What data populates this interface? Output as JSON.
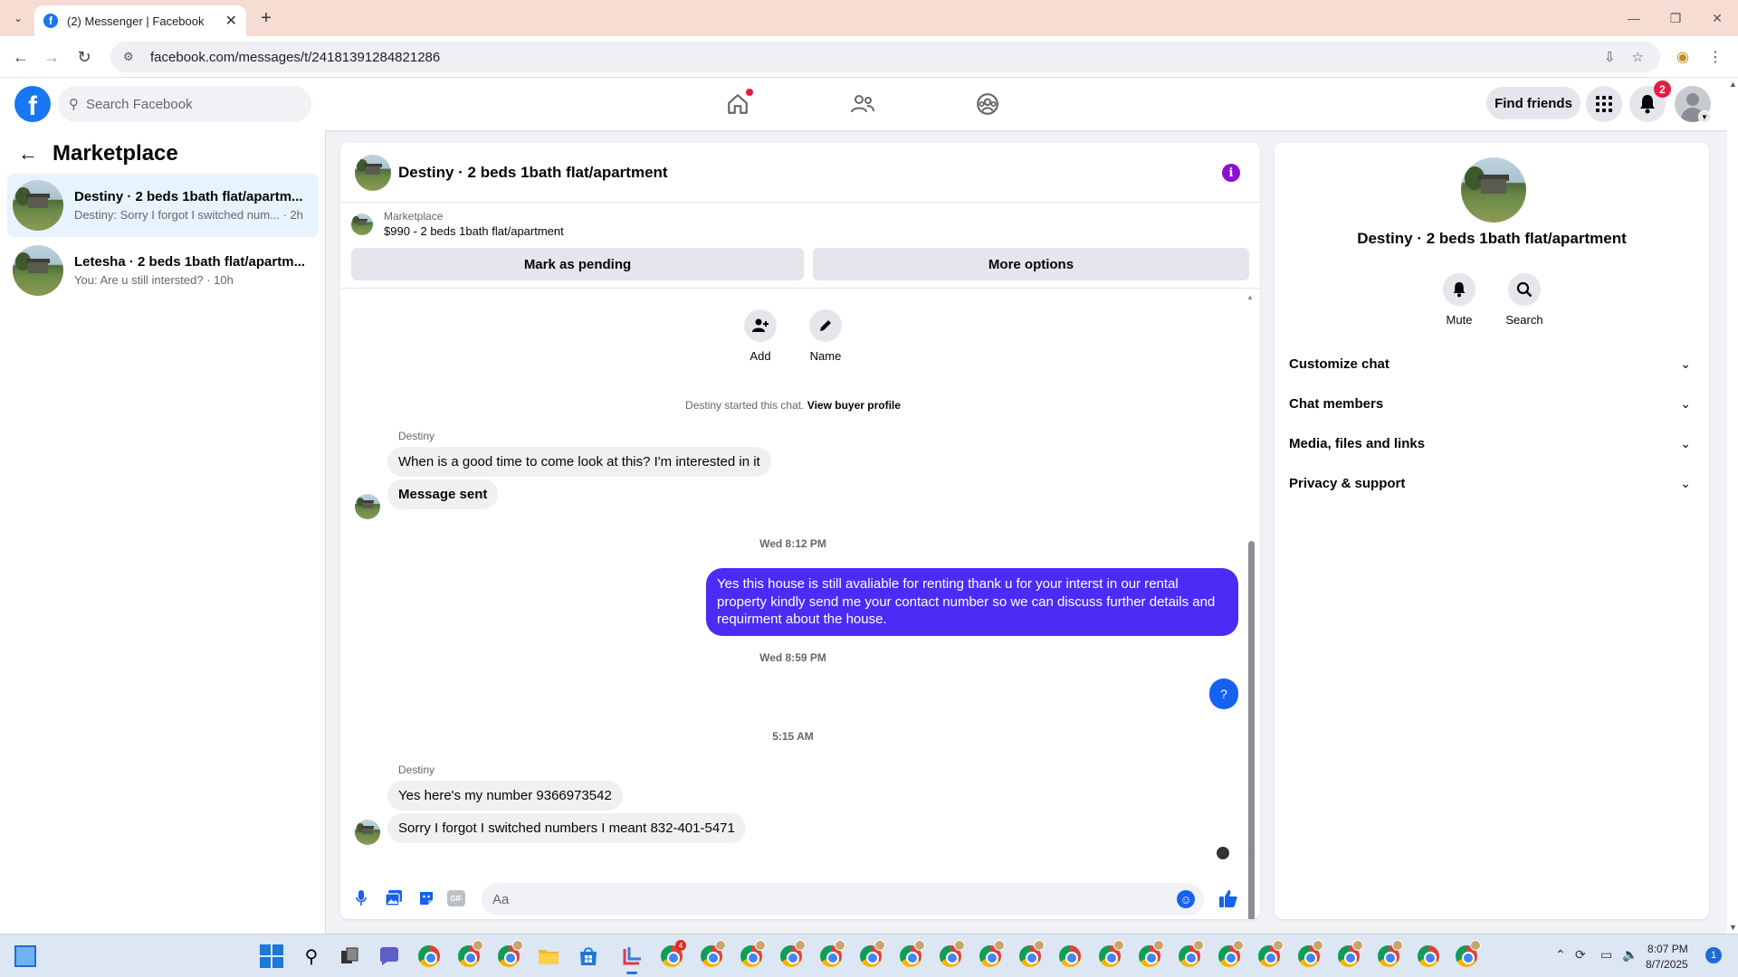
{
  "browser": {
    "tab_title": "(2) Messenger | Facebook",
    "url": "facebook.com/messages/t/24181391284821286"
  },
  "fb_nav": {
    "logo": "f",
    "search_placeholder": "Search Facebook",
    "find_friends": "Find friends",
    "notification_count": "2"
  },
  "left_panel": {
    "title": "Marketplace",
    "conversations": [
      {
        "name": "Destiny · 2 beds 1bath flat/apartm...",
        "snippet": "Destiny: Sorry I forgot I switched num... · 2h",
        "active": true
      },
      {
        "name": "Letesha · 2 beds 1bath flat/apartm...",
        "snippet": "You: Are u still intersted? · 10h",
        "active": false
      }
    ]
  },
  "chat": {
    "title": "Destiny · 2 beds 1bath flat/apartment",
    "info_icon": "i",
    "marketplace_label": "Marketplace",
    "listing": "$990 - 2 beds 1bath flat/apartment",
    "mark_pending": "Mark as pending",
    "more_options": "More options",
    "actions": [
      {
        "label": "Add",
        "icon": "add-person-icon"
      },
      {
        "label": "Name",
        "icon": "pencil-icon"
      }
    ],
    "system_msg": "Destiny started this chat.",
    "system_link": "View buyer profile",
    "messages": {
      "sender1": "Destiny",
      "m1": "When is a good time to come look at this? I'm interested in it",
      "m2": "Message sent",
      "ts1": "Wed 8:12 PM",
      "out1": "Yes this house is still avaliable for renting thank u for your interst in our rental property kindly send me your contact number so  we can discuss further details and requirment about the house.",
      "ts2": "Wed 8:59 PM",
      "out2": "?",
      "ts3": "5:15 AM",
      "sender2": "Destiny",
      "m3": "Yes here's my number 9366973542",
      "m4": "Sorry I forgot I switched numbers I meant 832-401-5471"
    },
    "composer_placeholder": "Aa",
    "gif_label": "GIF",
    "colors": {
      "outgoing": "#4a2cf5",
      "accent": "#1662f0"
    }
  },
  "right_panel": {
    "title": "Destiny · 2 beds 1bath flat/apartment",
    "mute": "Mute",
    "search": "Search",
    "sections": [
      "Customize chat",
      "Chat members",
      "Media, files and links",
      "Privacy & support"
    ]
  },
  "taskbar": {
    "time": "8:07 PM",
    "date": "8/7/2025",
    "notifications": "1"
  }
}
